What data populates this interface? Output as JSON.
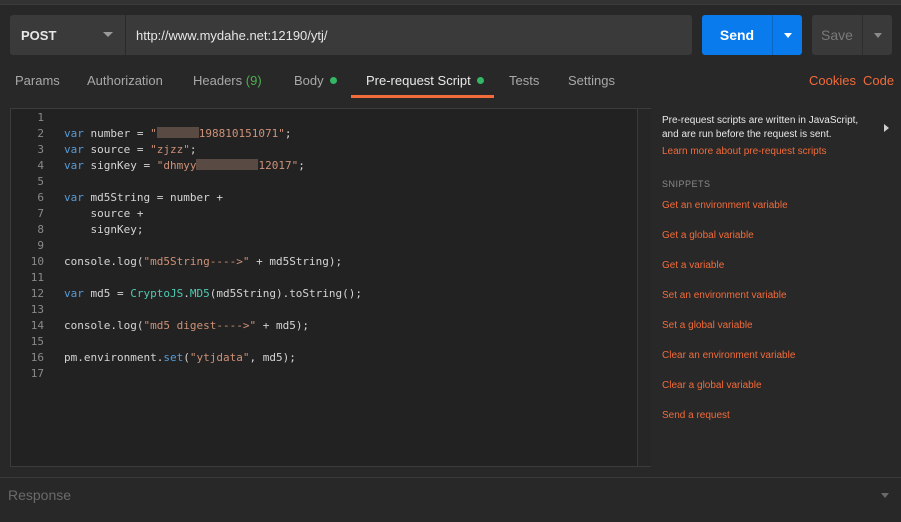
{
  "request": {
    "method": "POST",
    "url": "http://www.mydahe.net:12190/ytj/",
    "send_label": "Send",
    "save_label": "Save"
  },
  "tabs": [
    {
      "label": "Params"
    },
    {
      "label": "Authorization"
    },
    {
      "label": "Headers",
      "count": "(9)"
    },
    {
      "label": "Body"
    },
    {
      "label": "Pre-request Script"
    },
    {
      "label": "Tests"
    },
    {
      "label": "Settings"
    }
  ],
  "right_links": {
    "cookies": "Cookies",
    "code": "Code"
  },
  "editor": {
    "line_numbers": [
      "1",
      "2",
      "3",
      "4",
      "5",
      "6",
      "7",
      "8",
      "9",
      "10",
      "11",
      "12",
      "13",
      "14",
      "15",
      "16",
      "17"
    ],
    "code": {
      "l2_kw": "var",
      "l2_a": " number = ",
      "l2_q": "\"",
      "l2_b": "198810151071\"",
      "l2_end": ";",
      "l3_kw": "var",
      "l3_a": " source = ",
      "l3_str": "\"zjzz\"",
      "l3_end": ";",
      "l4_kw": "var",
      "l4_a": " signKey = ",
      "l4_s1": "\"dhmyy",
      "l4_s2": "12017\"",
      "l4_end": ";",
      "l6_kw": "var",
      "l6_a": " md5String = number +",
      "l7": "    source +",
      "l8": "    signKey;",
      "l10_a": "console.log(",
      "l10_str": "\"md5String---->\"",
      "l10_b": " + md5String);",
      "l12_kw": "var",
      "l12_a": " md5 = ",
      "l12_fn1": "CryptoJS",
      "l12_dot": ".",
      "l12_fn2": "MD5",
      "l12_b": "(md5String).toString();",
      "l14_a": "console.log(",
      "l14_str": "\"md5 digest---->\"",
      "l14_b": " + md5);",
      "l16_a": "pm.environment.",
      "l16_m": "set",
      "l16_b": "(",
      "l16_str": "\"ytjdata\"",
      "l16_c": ", md5);"
    }
  },
  "sidebar": {
    "info_line1": "Pre-request scripts are written in JavaScript,",
    "info_line2": "and are run before the request is sent.",
    "learn_more": "Learn more about pre-request scripts",
    "snippets_heading": "SNIPPETS",
    "snippets": [
      "Get an environment variable",
      "Get a global variable",
      "Get a variable",
      "Set an environment variable",
      "Set a global variable",
      "Clear an environment variable",
      "Clear a global variable",
      "Send a request"
    ]
  },
  "response": {
    "label": "Response"
  },
  "colors": {
    "accent": "#f26b3a",
    "send": "#097bed",
    "dot": "#33b764"
  }
}
